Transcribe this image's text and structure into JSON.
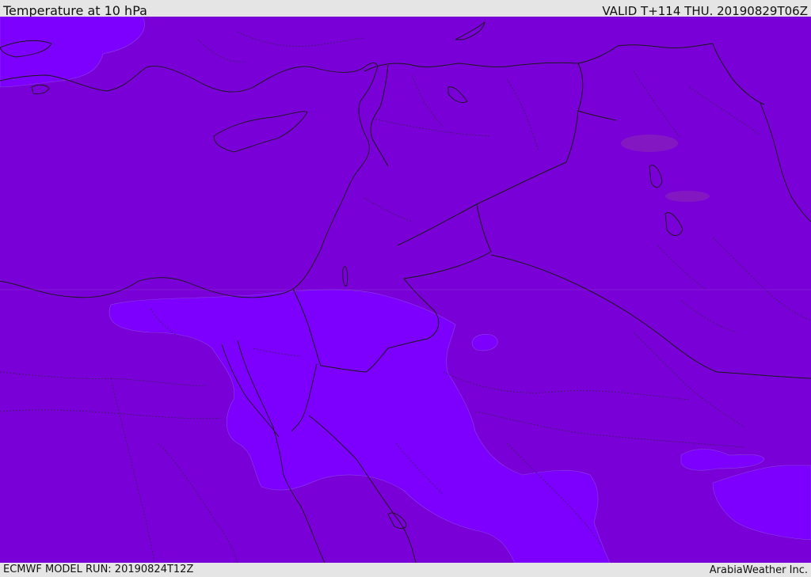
{
  "header": {
    "title": "Temperature at 10 hPa",
    "valid": "VALID T+114 THU. 20190829T06Z"
  },
  "footer": {
    "model_run": "ECMWF MODEL RUN: 20190824T12Z",
    "credit": "ArabiaWeather Inc."
  },
  "map": {
    "region": "Eastern Mediterranean and Middle East",
    "shading": {
      "base_color": "#7a00d8",
      "warmer_color": "#7d00ff",
      "darker_patch_color": "#8a2cb0"
    },
    "lines": {
      "coastline_color": "#1a1a1a",
      "border_color": "#1a1a1a",
      "admin_border_color": "#3a2060"
    }
  }
}
